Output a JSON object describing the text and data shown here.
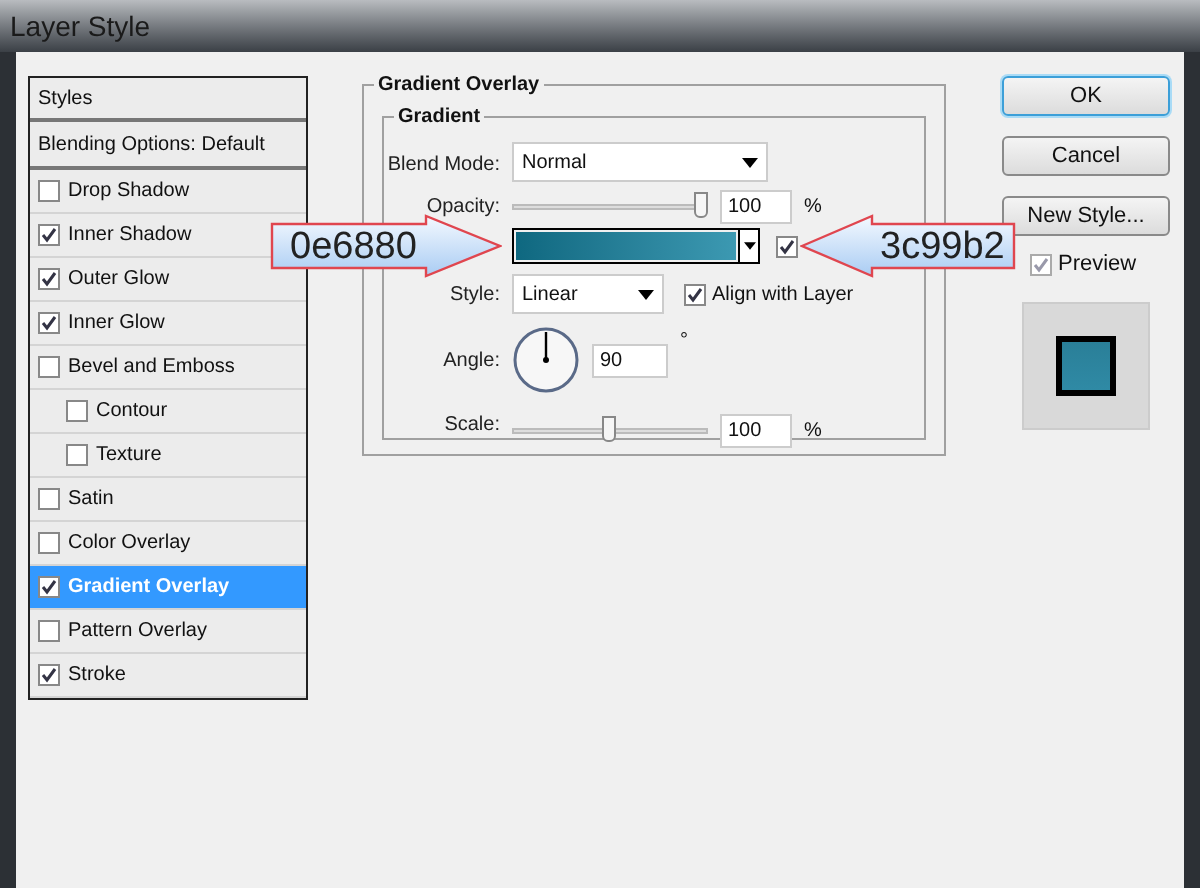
{
  "window": {
    "title": "Layer Style"
  },
  "sidebar": {
    "header": "Styles",
    "items": [
      {
        "label": "Blending Options: Default",
        "kind": "plain",
        "selected": false
      },
      {
        "label": "Drop Shadow",
        "kind": "check",
        "checked": false,
        "selected": false
      },
      {
        "label": "Inner Shadow",
        "kind": "check",
        "checked": true,
        "selected": false
      },
      {
        "label": "Outer Glow",
        "kind": "check",
        "checked": true,
        "selected": false
      },
      {
        "label": "Inner Glow",
        "kind": "check",
        "checked": true,
        "selected": false
      },
      {
        "label": "Bevel and Emboss",
        "kind": "check",
        "checked": false,
        "selected": false,
        "children": [
          {
            "label": "Contour",
            "kind": "check",
            "checked": false,
            "selected": false
          },
          {
            "label": "Texture",
            "kind": "check",
            "checked": false,
            "selected": false
          }
        ]
      },
      {
        "label": "Satin",
        "kind": "check",
        "checked": false,
        "selected": false
      },
      {
        "label": "Color Overlay",
        "kind": "check",
        "checked": false,
        "selected": false
      },
      {
        "label": "Gradient Overlay",
        "kind": "check",
        "checked": true,
        "selected": true
      },
      {
        "label": "Pattern Overlay",
        "kind": "check",
        "checked": false,
        "selected": false
      },
      {
        "label": "Stroke",
        "kind": "check",
        "checked": true,
        "selected": false
      }
    ]
  },
  "panel": {
    "title": "Gradient Overlay",
    "group": "Gradient",
    "blend_mode": {
      "label": "Blend Mode:",
      "value": "Normal"
    },
    "opacity": {
      "label": "Opacity:",
      "level": 0.97,
      "value": "100",
      "unit": "%"
    },
    "gradient": {
      "reverse_checked": true
    },
    "style": {
      "label": "Style:",
      "value": "Linear"
    },
    "align": {
      "label": "Align with Layer",
      "checked": true
    },
    "angle": {
      "label": "Angle:",
      "value": "90",
      "unit": "°"
    },
    "scale": {
      "label": "Scale:",
      "level": 0.5,
      "value": "100",
      "unit": "%"
    }
  },
  "buttons": [
    {
      "label": "OK",
      "default": true
    },
    {
      "label": "Cancel",
      "default": false
    },
    {
      "label": "New Style...",
      "default": false
    }
  ],
  "preview": {
    "label": "Preview",
    "checked": true
  },
  "callouts": [
    {
      "text": "0e6880",
      "kind": "rightward"
    },
    {
      "text": "3c99b2",
      "kind": "leftward"
    }
  ]
}
